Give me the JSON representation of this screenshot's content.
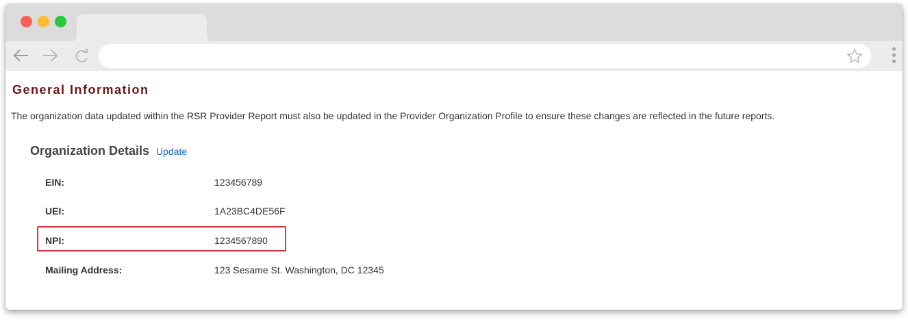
{
  "browser": {
    "tab_title": "",
    "address": "",
    "colors": {
      "close": "#fe5f57",
      "minimize": "#febc2e",
      "maximize": "#28c840"
    }
  },
  "page": {
    "title": "General Information",
    "intro": "The organization data updated within the RSR Provider Report must also be updated in the Provider Organization Profile to ensure these changes are reflected in the future reports.",
    "section": {
      "title": "Organization Details",
      "update_label": "Update"
    },
    "details": [
      {
        "label": "EIN:",
        "value": "123456789"
      },
      {
        "label": "UEI:",
        "value": "1A23BC4DE56F"
      },
      {
        "label": "NPI:",
        "value": "1234567890"
      },
      {
        "label": "Mailing Address:",
        "value": "123 Sesame St. Washington, DC 12345"
      }
    ],
    "highlight_color": "#d8333f",
    "title_color": "#6b1515",
    "link_color": "#1a66c2"
  }
}
